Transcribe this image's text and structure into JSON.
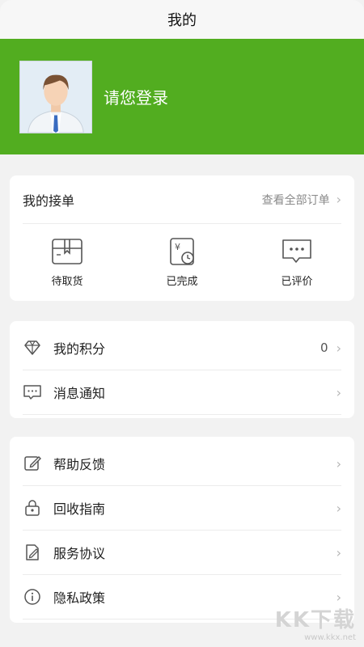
{
  "topbar": {
    "title": "我的"
  },
  "profile": {
    "login_text": "请您登录"
  },
  "orders": {
    "title": "我的接单",
    "view_all": "查看全部订单",
    "items": [
      {
        "label": "待取货",
        "icon": "box-icon"
      },
      {
        "label": "已完成",
        "icon": "receipt-clock-icon"
      },
      {
        "label": "已评价",
        "icon": "chat-bubble-icon"
      }
    ]
  },
  "section1": {
    "items": [
      {
        "label": "我的积分",
        "value": "0",
        "icon": "diamond-icon"
      },
      {
        "label": "消息通知",
        "icon": "message-icon"
      }
    ]
  },
  "section2": {
    "items": [
      {
        "label": "帮助反馈",
        "icon": "edit-icon"
      },
      {
        "label": "回收指南",
        "icon": "lock-icon"
      },
      {
        "label": "服务协议",
        "icon": "document-edit-icon"
      },
      {
        "label": "隐私政策",
        "icon": "info-icon"
      }
    ]
  },
  "watermark": {
    "logo": "KK下载",
    "url": "www.kkx.net"
  },
  "colors": {
    "brand_green": "#52ad20"
  }
}
